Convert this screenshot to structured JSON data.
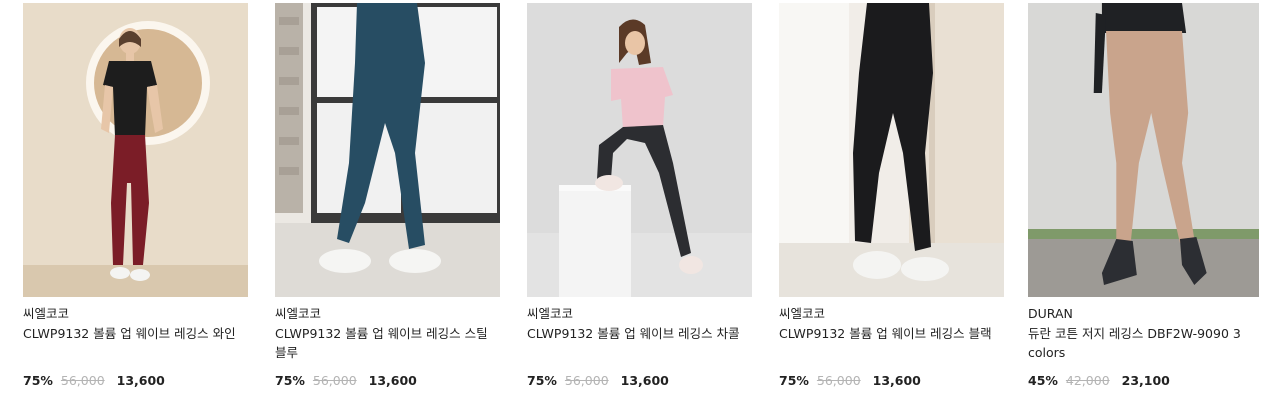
{
  "products": [
    {
      "brand": "씨엘코코",
      "name": "CLWP9132 볼륨 업 웨이브 레깅스 와인",
      "discount": "75%",
      "original_price": "56,000",
      "sale_price": "13,600",
      "image_alt": "model-wine-leggings"
    },
    {
      "brand": "씨엘코코",
      "name": "CLWP9132 볼륨 업 웨이브 레깅스 스틸블루",
      "discount": "75%",
      "original_price": "56,000",
      "sale_price": "13,600",
      "image_alt": "model-steelblue-leggings"
    },
    {
      "brand": "씨엘코코",
      "name": "CLWP9132 볼륨 업 웨이브 레깅스 차콜",
      "discount": "75%",
      "original_price": "56,000",
      "sale_price": "13,600",
      "image_alt": "model-charcoal-leggings"
    },
    {
      "brand": "씨엘코코",
      "name": "CLWP9132 볼륨 업 웨이브 레깅스 블랙",
      "discount": "75%",
      "original_price": "56,000",
      "sale_price": "13,600",
      "image_alt": "model-black-leggings"
    },
    {
      "brand": "DURAN",
      "name": "듀란 코튼 저지 레깅스 DBF2W-9090 3colors",
      "discount": "45%",
      "original_price": "42,000",
      "sale_price": "23,100",
      "image_alt": "model-beige-leggings"
    }
  ]
}
